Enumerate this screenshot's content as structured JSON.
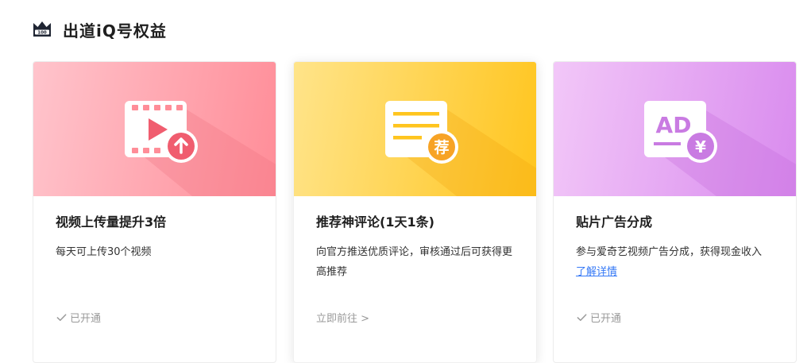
{
  "section": {
    "title": "出道iQ号权益",
    "icon": "crown-100-icon"
  },
  "cards": [
    {
      "title": "视频上传量提升3倍",
      "desc": "每天可上传30个视频",
      "status": "已开通",
      "banner_color": "#ff8d98",
      "icon": "video-upload-icon"
    },
    {
      "title": "推荐神评论(1天1条)",
      "desc": "向官方推送优质评论，审核通过后可获得更高推荐",
      "action": "立即前往 >",
      "banner_color": "#ffc51e",
      "icon": "recommend-comment-icon",
      "badge": "荐"
    },
    {
      "title": "贴片广告分成",
      "desc_prefix": "参与爱奇艺视频广告分成，获得现金收入",
      "desc_link": "了解详情",
      "status": "已开通",
      "banner_color": "#d98bee",
      "icon": "ad-revenue-icon",
      "ad_text": "AD",
      "currency": "¥"
    }
  ],
  "colors": {
    "pink": "#ff8d98",
    "yellow": "#ffc51e",
    "purple": "#d98bee",
    "link": "#3478f6"
  }
}
